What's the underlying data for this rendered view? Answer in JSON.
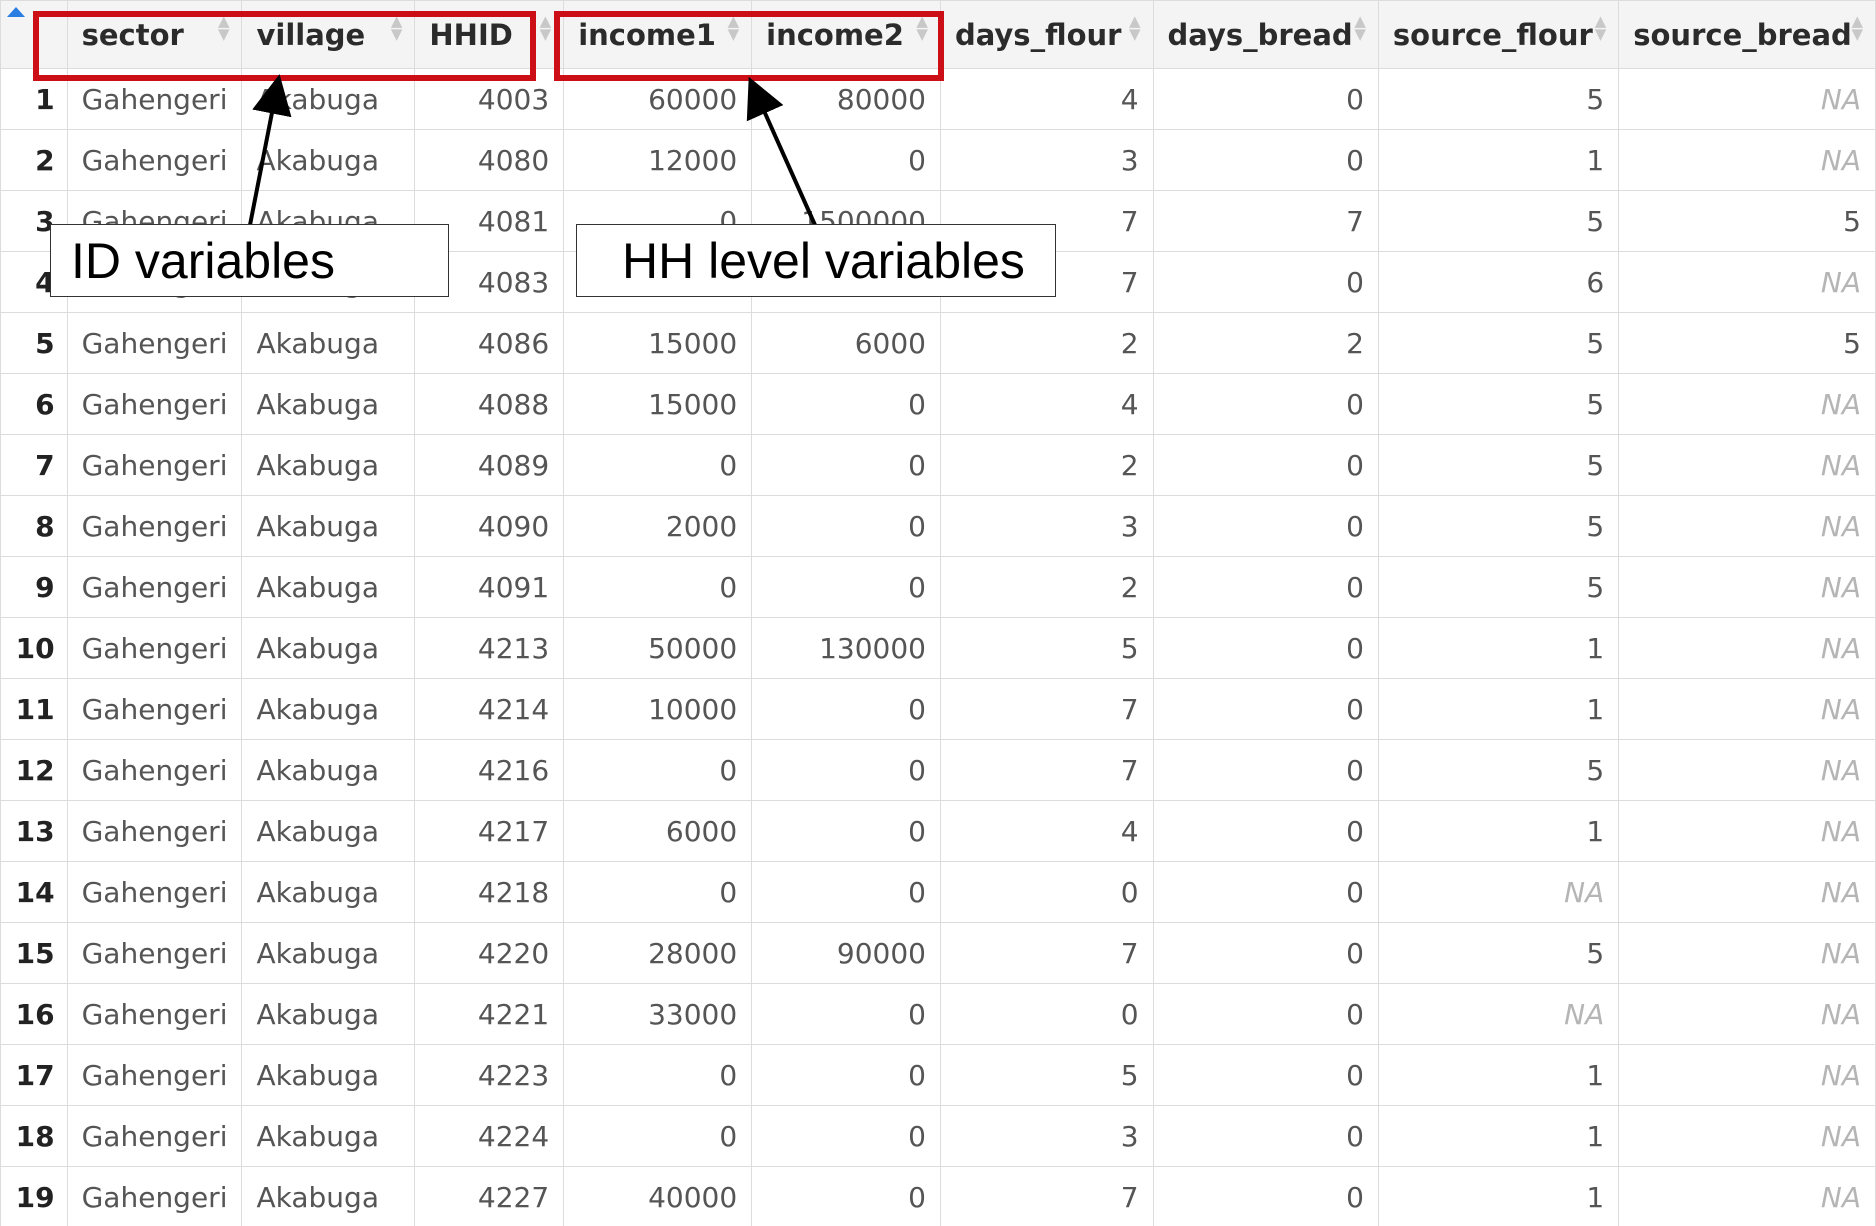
{
  "table": {
    "columns": [
      {
        "key": "sector",
        "label": "sector",
        "align": "left"
      },
      {
        "key": "village",
        "label": "village",
        "align": "left"
      },
      {
        "key": "HHID",
        "label": "HHID",
        "align": "right"
      },
      {
        "key": "income1",
        "label": "income1",
        "align": "right"
      },
      {
        "key": "income2",
        "label": "income2",
        "align": "right"
      },
      {
        "key": "days_flour",
        "label": "days_flour",
        "align": "right"
      },
      {
        "key": "days_bread",
        "label": "days_bread",
        "align": "right"
      },
      {
        "key": "source_flour",
        "label": "source_flour",
        "align": "right"
      },
      {
        "key": "source_bread",
        "label": "source_bread",
        "align": "right"
      }
    ],
    "rows": [
      {
        "n": "1",
        "sector": "Gahengeri",
        "village": "Akabuga",
        "HHID": "4003",
        "income1": "60000",
        "income2": "80000",
        "days_flour": "4",
        "days_bread": "0",
        "source_flour": "5",
        "source_bread": "NA"
      },
      {
        "n": "2",
        "sector": "Gahengeri",
        "village": "Akabuga",
        "HHID": "4080",
        "income1": "12000",
        "income2": "0",
        "days_flour": "3",
        "days_bread": "0",
        "source_flour": "1",
        "source_bread": "NA"
      },
      {
        "n": "3",
        "sector": "Gahengeri",
        "village": "Akabuga",
        "HHID": "4081",
        "income1": "0",
        "income2": "1500000",
        "days_flour": "7",
        "days_bread": "7",
        "source_flour": "5",
        "source_bread": "5"
      },
      {
        "n": "4",
        "sector": "Gahengeri",
        "village": "Akabuga",
        "HHID": "4083",
        "income1": "",
        "income2": "",
        "days_flour": "7",
        "days_bread": "0",
        "source_flour": "6",
        "source_bread": "NA"
      },
      {
        "n": "5",
        "sector": "Gahengeri",
        "village": "Akabuga",
        "HHID": "4086",
        "income1": "15000",
        "income2": "6000",
        "days_flour": "2",
        "days_bread": "2",
        "source_flour": "5",
        "source_bread": "5"
      },
      {
        "n": "6",
        "sector": "Gahengeri",
        "village": "Akabuga",
        "HHID": "4088",
        "income1": "15000",
        "income2": "0",
        "days_flour": "4",
        "days_bread": "0",
        "source_flour": "5",
        "source_bread": "NA"
      },
      {
        "n": "7",
        "sector": "Gahengeri",
        "village": "Akabuga",
        "HHID": "4089",
        "income1": "0",
        "income2": "0",
        "days_flour": "2",
        "days_bread": "0",
        "source_flour": "5",
        "source_bread": "NA"
      },
      {
        "n": "8",
        "sector": "Gahengeri",
        "village": "Akabuga",
        "HHID": "4090",
        "income1": "2000",
        "income2": "0",
        "days_flour": "3",
        "days_bread": "0",
        "source_flour": "5",
        "source_bread": "NA"
      },
      {
        "n": "9",
        "sector": "Gahengeri",
        "village": "Akabuga",
        "HHID": "4091",
        "income1": "0",
        "income2": "0",
        "days_flour": "2",
        "days_bread": "0",
        "source_flour": "5",
        "source_bread": "NA"
      },
      {
        "n": "10",
        "sector": "Gahengeri",
        "village": "Akabuga",
        "HHID": "4213",
        "income1": "50000",
        "income2": "130000",
        "days_flour": "5",
        "days_bread": "0",
        "source_flour": "1",
        "source_bread": "NA"
      },
      {
        "n": "11",
        "sector": "Gahengeri",
        "village": "Akabuga",
        "HHID": "4214",
        "income1": "10000",
        "income2": "0",
        "days_flour": "7",
        "days_bread": "0",
        "source_flour": "1",
        "source_bread": "NA"
      },
      {
        "n": "12",
        "sector": "Gahengeri",
        "village": "Akabuga",
        "HHID": "4216",
        "income1": "0",
        "income2": "0",
        "days_flour": "7",
        "days_bread": "0",
        "source_flour": "5",
        "source_bread": "NA"
      },
      {
        "n": "13",
        "sector": "Gahengeri",
        "village": "Akabuga",
        "HHID": "4217",
        "income1": "6000",
        "income2": "0",
        "days_flour": "4",
        "days_bread": "0",
        "source_flour": "1",
        "source_bread": "NA"
      },
      {
        "n": "14",
        "sector": "Gahengeri",
        "village": "Akabuga",
        "HHID": "4218",
        "income1": "0",
        "income2": "0",
        "days_flour": "0",
        "days_bread": "0",
        "source_flour": "NA",
        "source_bread": "NA"
      },
      {
        "n": "15",
        "sector": "Gahengeri",
        "village": "Akabuga",
        "HHID": "4220",
        "income1": "28000",
        "income2": "90000",
        "days_flour": "7",
        "days_bread": "0",
        "source_flour": "5",
        "source_bread": "NA"
      },
      {
        "n": "16",
        "sector": "Gahengeri",
        "village": "Akabuga",
        "HHID": "4221",
        "income1": "33000",
        "income2": "0",
        "days_flour": "0",
        "days_bread": "0",
        "source_flour": "NA",
        "source_bread": "NA"
      },
      {
        "n": "17",
        "sector": "Gahengeri",
        "village": "Akabuga",
        "HHID": "4223",
        "income1": "0",
        "income2": "0",
        "days_flour": "5",
        "days_bread": "0",
        "source_flour": "1",
        "source_bread": "NA"
      },
      {
        "n": "18",
        "sector": "Gahengeri",
        "village": "Akabuga",
        "HHID": "4224",
        "income1": "0",
        "income2": "0",
        "days_flour": "3",
        "days_bread": "0",
        "source_flour": "1",
        "source_bread": "NA"
      },
      {
        "n": "19",
        "sector": "Gahengeri",
        "village": "Akabuga",
        "HHID": "4227",
        "income1": "40000",
        "income2": "0",
        "days_flour": "7",
        "days_bread": "0",
        "source_flour": "1",
        "source_bread": "NA"
      }
    ]
  },
  "annotations": {
    "id_label": "ID variables",
    "hh_label": "HH level variables",
    "highlight_color": "#cc0f16"
  }
}
